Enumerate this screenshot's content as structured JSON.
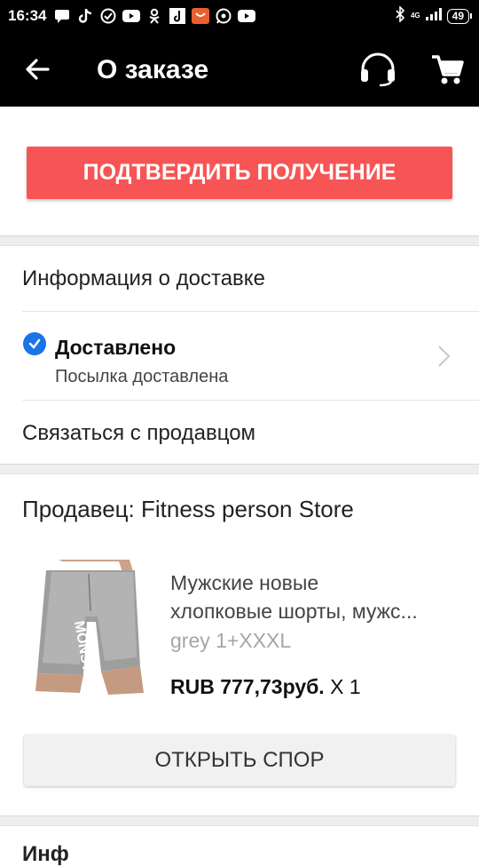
{
  "status_bar": {
    "time": "16:34",
    "battery": "49",
    "network": "4G",
    "notification_icons": [
      "message-icon",
      "tiktok-icon",
      "check-circle-icon",
      "youtube-icon",
      "odnoklassniki-icon",
      "music-icon",
      "shopping-bag-icon",
      "whatsapp-icon",
      "youtube-icon"
    ]
  },
  "app_bar": {
    "title": "О заказе",
    "back_icon": "arrow-back-icon",
    "support_icon": "headset-icon",
    "cart_icon": "cart-icon"
  },
  "confirm": {
    "label": "ПОДТВЕРДИТЬ ПОЛУЧЕНИЕ",
    "color": "#f75555"
  },
  "delivery": {
    "heading": "Информация о доставке",
    "status_title": "Доставлено",
    "status_subtitle": "Посылка доставлена",
    "contact_seller": "Связаться с продавцом"
  },
  "order": {
    "seller_label": "Продавец: Fitness person Store",
    "product": {
      "name_line1": "Мужские новые",
      "name_line2": "хлопковые шорты, мужс...",
      "variant": "grey 1+XXXL",
      "price": "RUB 777,73руб.",
      "quantity": "X 1",
      "image_label": "MONSTA"
    },
    "dispute_label": "ОТКРЫТЬ СПОР"
  },
  "next_section_partial": "Инф"
}
